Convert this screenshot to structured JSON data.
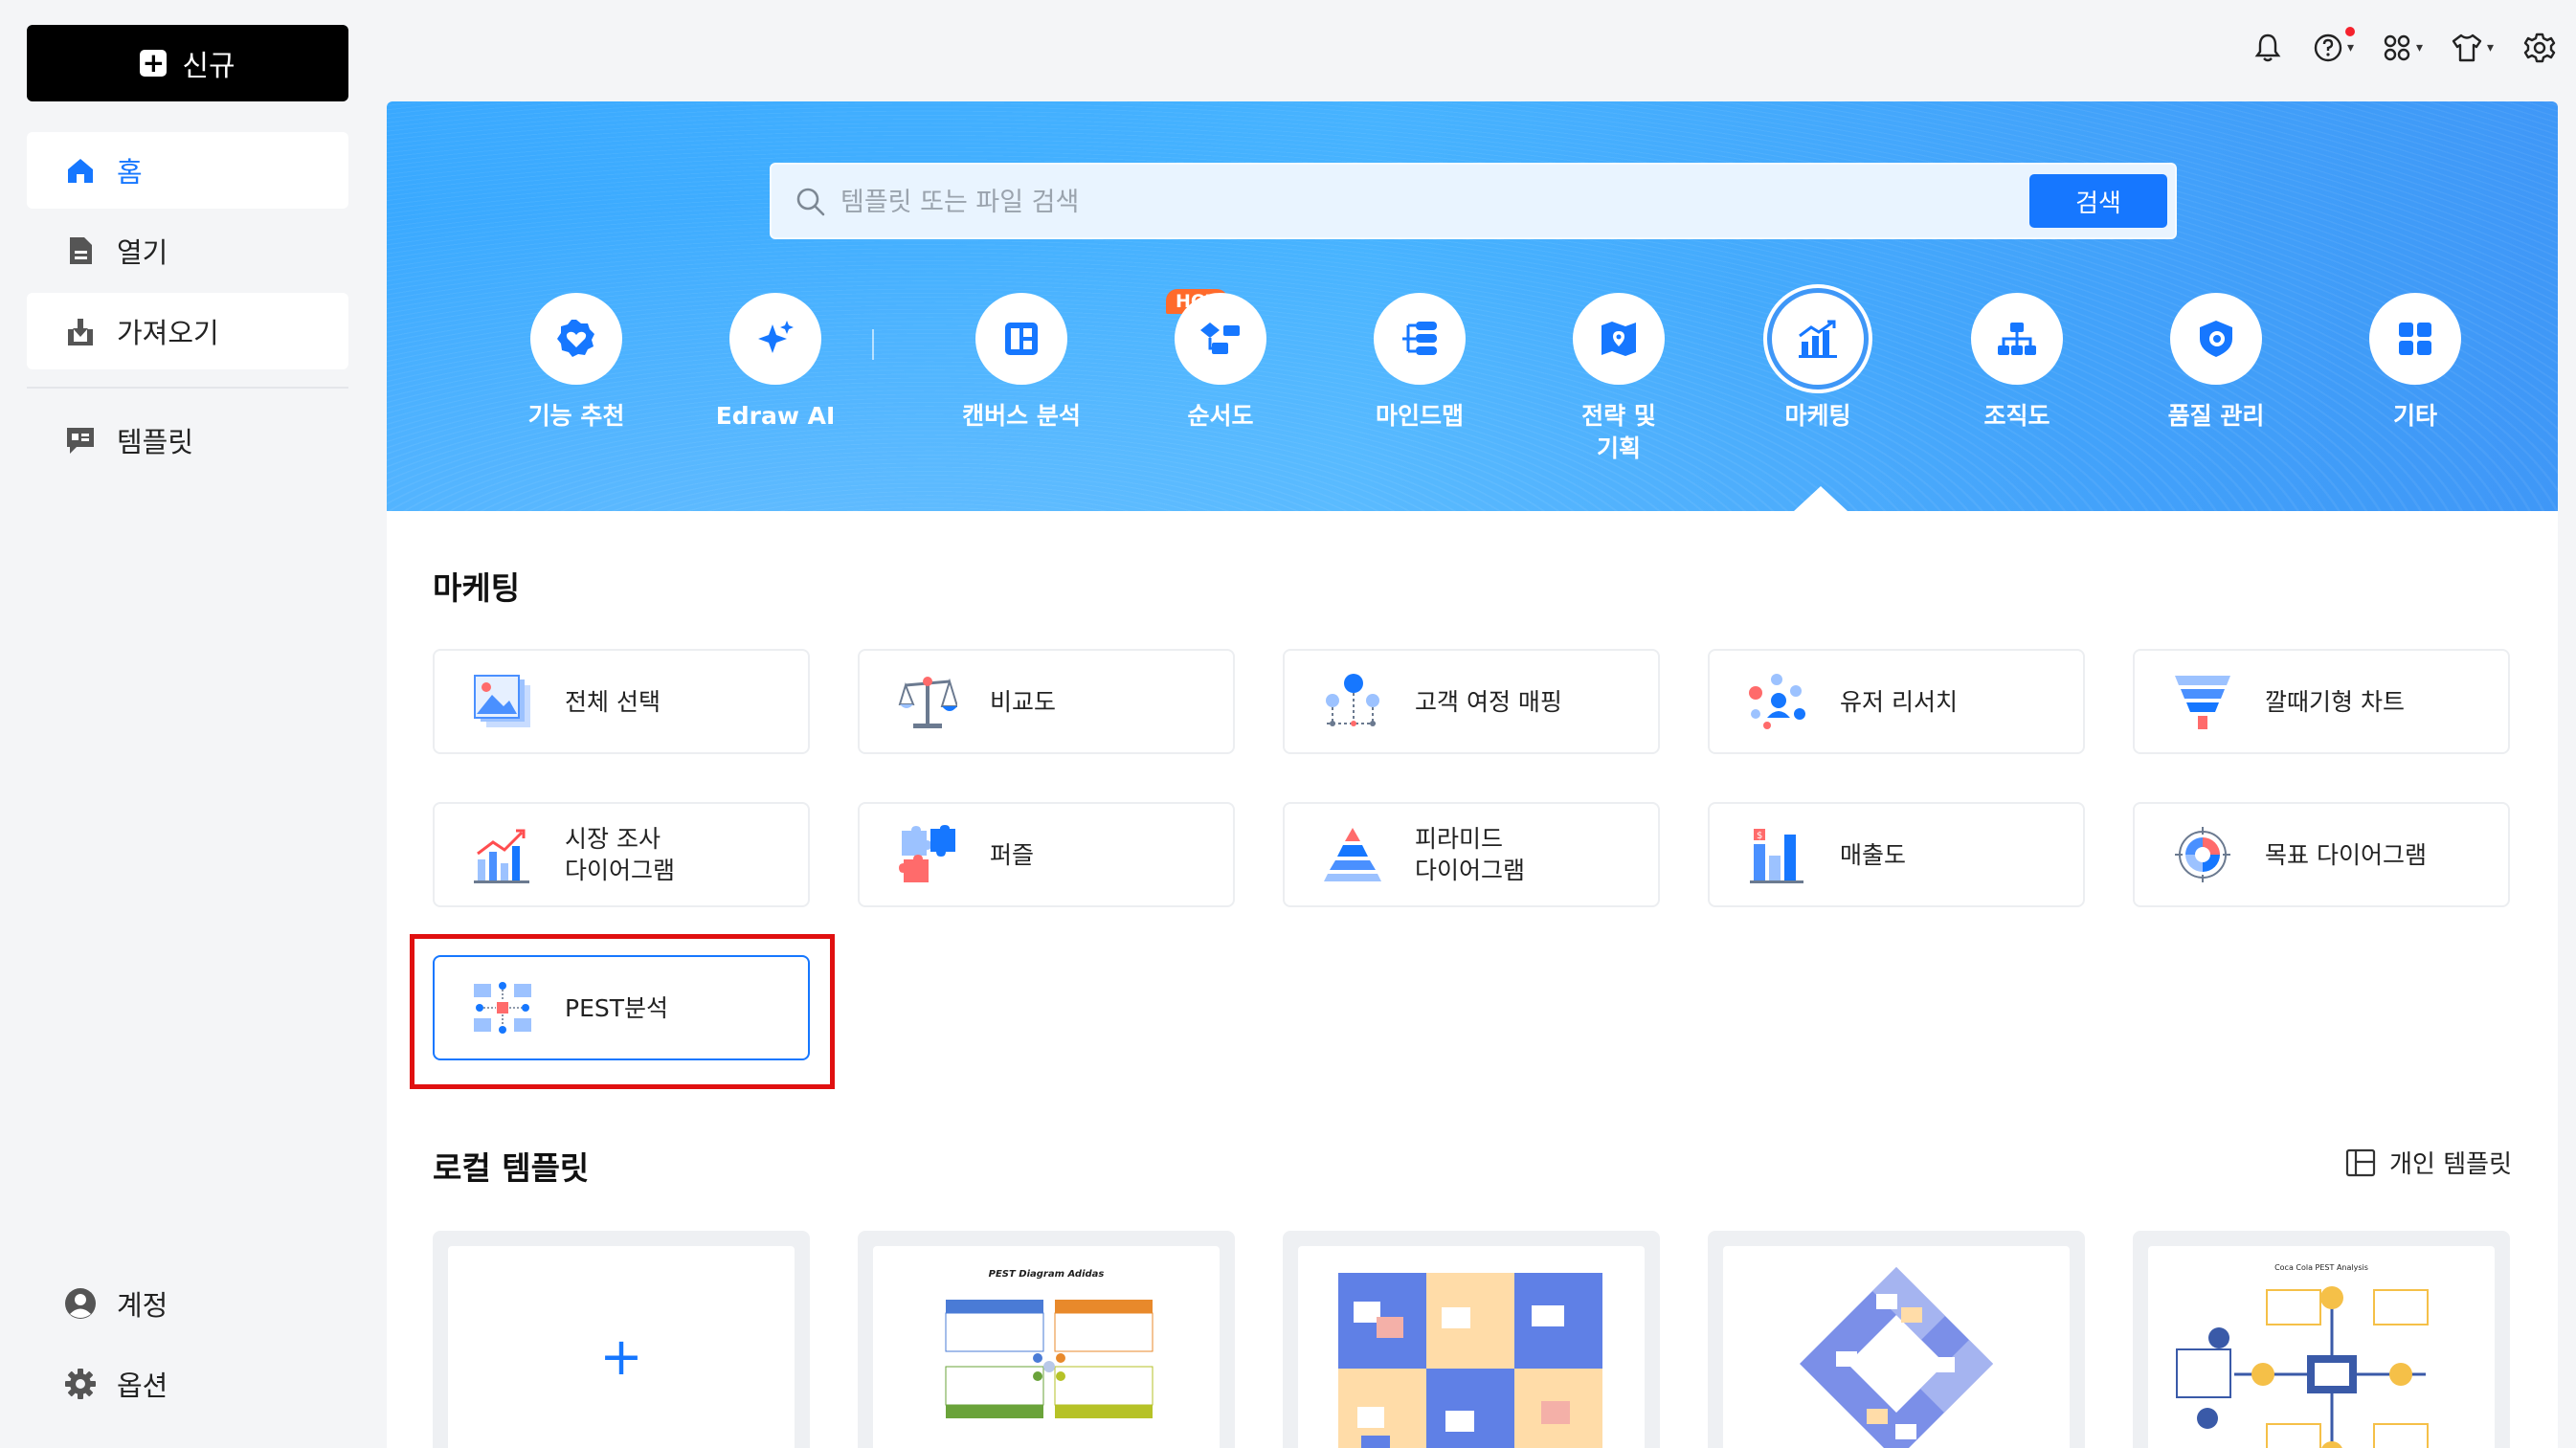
{
  "sidebar": {
    "new_label": "신규",
    "items": [
      {
        "label": "홈"
      },
      {
        "label": "열기"
      },
      {
        "label": "가져오기"
      },
      {
        "label": "템플릿"
      }
    ],
    "bottom": [
      {
        "label": "계정"
      },
      {
        "label": "옵션"
      }
    ]
  },
  "search": {
    "placeholder": "템플릿 또는 파일 검색",
    "button": "검색"
  },
  "categories": [
    {
      "label": "기능 추천",
      "icon": "badge-heart-icon"
    },
    {
      "label": "Edraw AI",
      "icon": "ai-sparkle-icon",
      "badge": "HOT"
    },
    {
      "label": "캔버스 분석",
      "icon": "canvas-grid-icon"
    },
    {
      "label": "순서도",
      "icon": "flowchart-icon"
    },
    {
      "label": "마인드맵",
      "icon": "mindmap-icon"
    },
    {
      "label": "전략 및\n기획",
      "icon": "strategy-map-icon"
    },
    {
      "label": "마케팅",
      "icon": "marketing-chart-icon",
      "active": true
    },
    {
      "label": "조직도",
      "icon": "org-chart-icon"
    },
    {
      "label": "품질 관리",
      "icon": "quality-icon"
    },
    {
      "label": "기타",
      "icon": "grid-icon"
    }
  ],
  "marketing": {
    "title": "마케팅",
    "cards": [
      {
        "label": "전체 선택",
        "icon": "image-stack-icon"
      },
      {
        "label": "비교도",
        "icon": "scale-icon"
      },
      {
        "label": "고객 여정 매핑",
        "icon": "journey-icon"
      },
      {
        "label": "유저 리서치",
        "icon": "user-research-icon"
      },
      {
        "label": "깔때기형 차트",
        "icon": "funnel-icon"
      },
      {
        "label": "시장 조사\n다이어그램",
        "icon": "market-bars-icon"
      },
      {
        "label": "퍼즐",
        "icon": "puzzle-icon"
      },
      {
        "label": "피라미드\n다이어그램",
        "icon": "pyramid-icon"
      },
      {
        "label": "매출도",
        "icon": "sales-bars-icon"
      },
      {
        "label": "목표 다이어그램",
        "icon": "target-icon"
      },
      {
        "label": "PEST분석",
        "icon": "pest-icon",
        "selected": true
      }
    ]
  },
  "local": {
    "title": "로컬 템플릿",
    "personal_label": "개인 템플릿",
    "templates": [
      {
        "kind": "new",
        "symbol": "+"
      },
      {
        "kind": "thumb",
        "title": "PEST Diagram Adidas"
      },
      {
        "kind": "thumb",
        "title": ""
      },
      {
        "kind": "thumb",
        "title": ""
      },
      {
        "kind": "thumb",
        "title": "Coca Cola PEST Analysis"
      }
    ]
  },
  "colors": {
    "accent": "#1677ff",
    "highlight": "#e01010",
    "hot": "#ff6a2b"
  }
}
